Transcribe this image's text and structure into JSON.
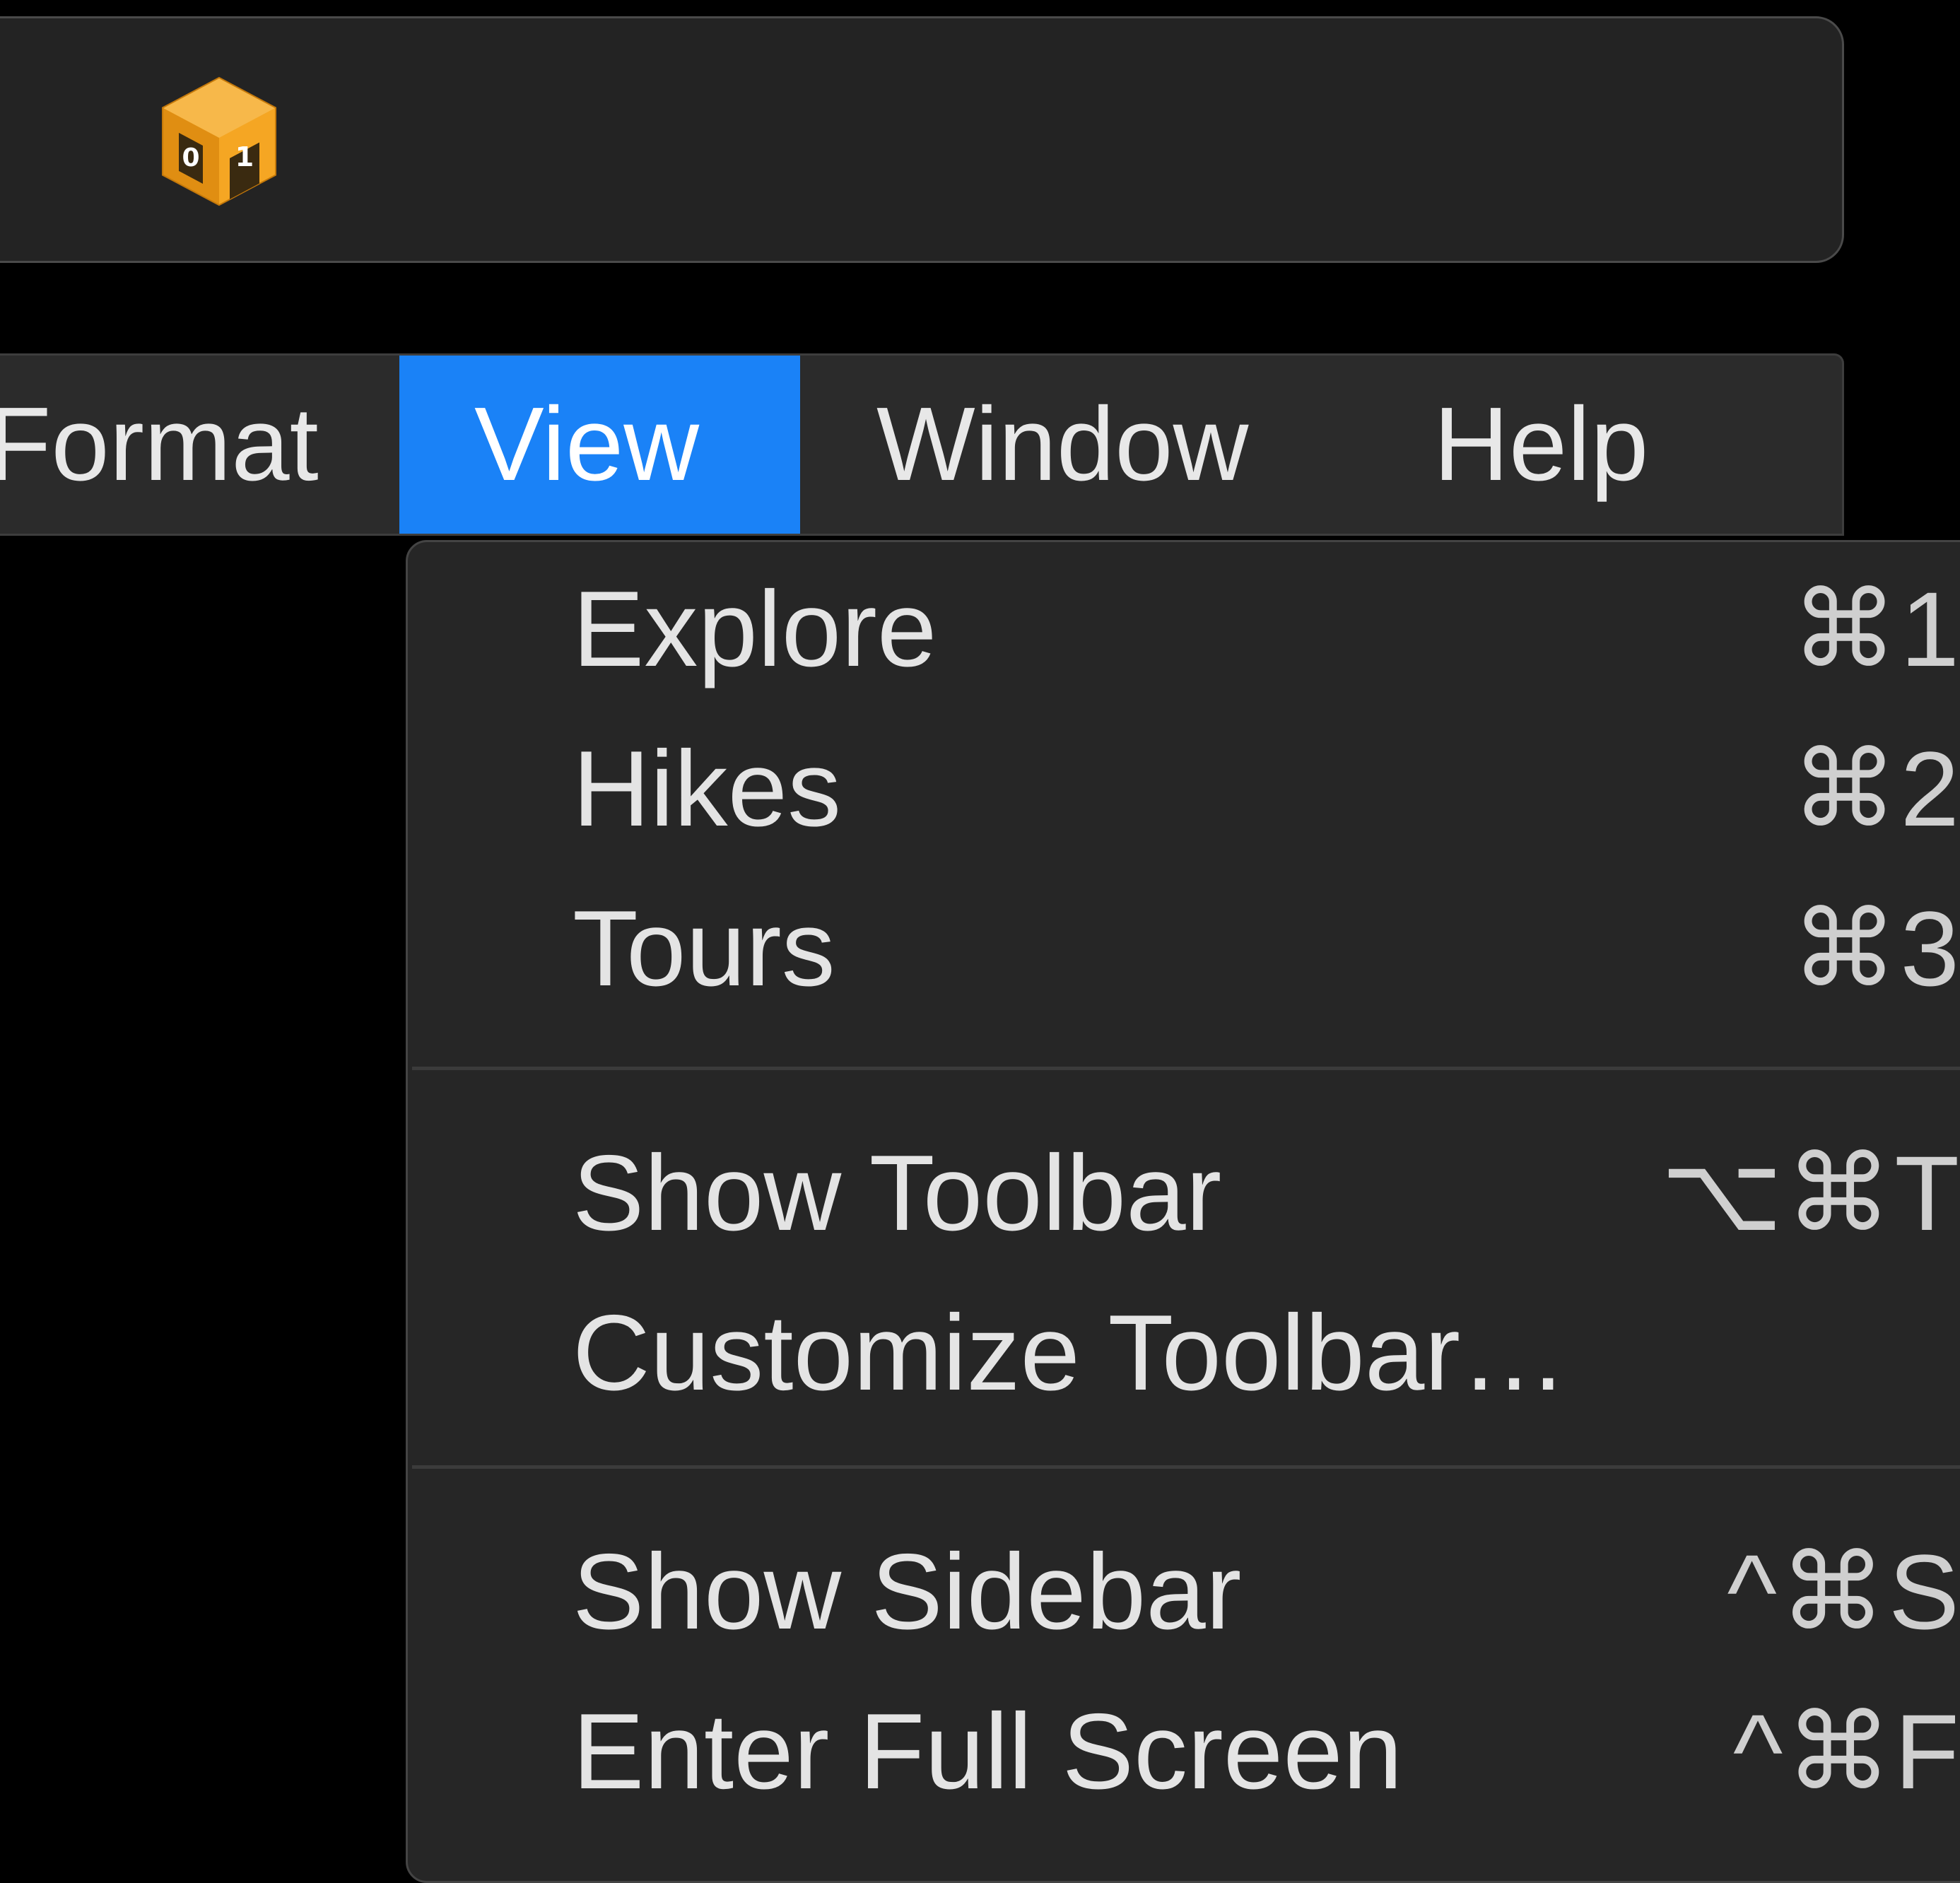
{
  "colors": {
    "background": "#000000",
    "panel": "#232323",
    "menubar": "#2b2b2b",
    "menu_highlight": "#1a82f7",
    "dropdown": "#262626",
    "separator": "#3b3b3b",
    "app_icon": "#f5a623"
  },
  "toolbar": {
    "app_icon": "app-box-icon",
    "app_icon_badge_left": "0",
    "app_icon_badge_right": "1"
  },
  "menubar": {
    "items": [
      {
        "label": "Format"
      },
      {
        "label": "View",
        "active": true
      },
      {
        "label": "Window"
      },
      {
        "label": "Help"
      }
    ]
  },
  "view_menu": {
    "groups": [
      [
        {
          "label": "Explore",
          "shortcut": "⌘1"
        },
        {
          "label": "Hikes",
          "shortcut": "⌘2"
        },
        {
          "label": "Tours",
          "shortcut": "⌘3"
        }
      ],
      [
        {
          "label": "Show Toolbar",
          "shortcut": "⌥⌘T"
        },
        {
          "label": "Customize Toolbar…",
          "shortcut": ""
        }
      ],
      [
        {
          "label": "Show Sidebar",
          "shortcut": "^⌘S"
        },
        {
          "label": "Enter Full Screen",
          "shortcut": "^⌘F"
        }
      ]
    ]
  }
}
